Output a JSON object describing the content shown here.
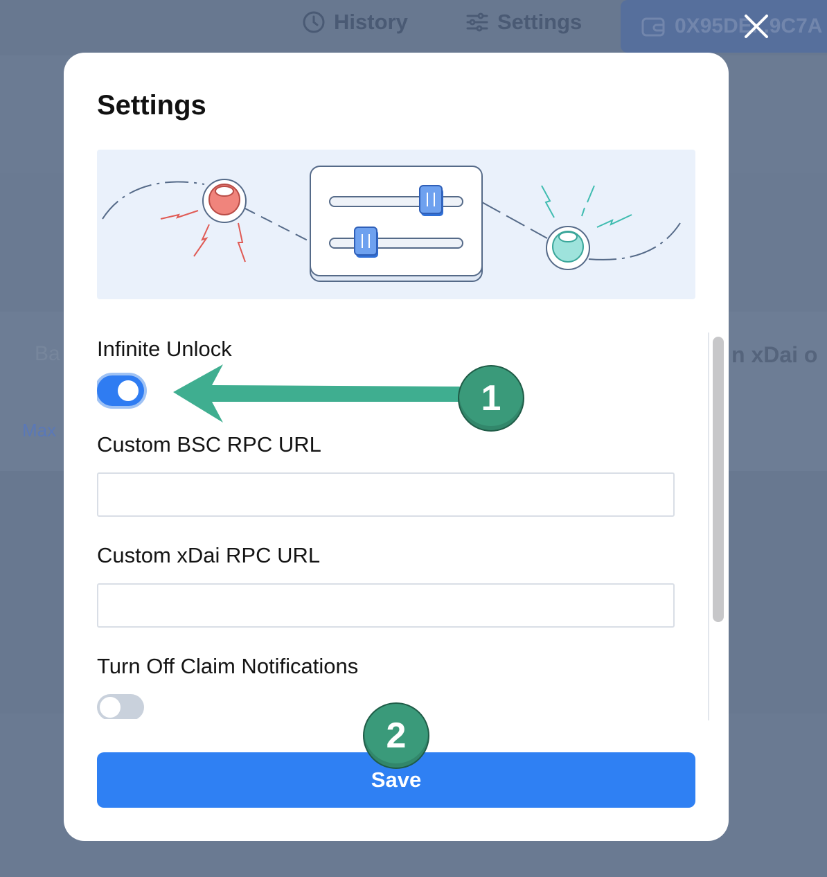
{
  "nav": {
    "history_label": "History",
    "settings_label": "Settings",
    "wallet_label": "0X95DE...9C7A"
  },
  "background": {
    "balance_fragment": "Ba",
    "xdai_fragment": "n xDai o",
    "max_label": "Max"
  },
  "modal": {
    "title": "Settings",
    "fields": {
      "infinite_unlock": {
        "label": "Infinite Unlock",
        "enabled": true
      },
      "bsc_rpc": {
        "label": "Custom BSC RPC URL",
        "value": "",
        "placeholder": ""
      },
      "xdai_rpc": {
        "label": "Custom xDai RPC URL",
        "value": "",
        "placeholder": ""
      },
      "claim_notifications": {
        "label": "Turn Off Claim Notifications",
        "enabled": false
      }
    },
    "save_label": "Save"
  },
  "annotations": {
    "step1": "1",
    "step2": "2"
  },
  "colors": {
    "accent": "#2f80f3",
    "annotation_green": "#3a9a7a",
    "overlay": "#687890"
  },
  "icons": {
    "history": "clock-icon",
    "settings": "sliders-icon",
    "wallet": "wallet-icon",
    "close": "close-icon"
  }
}
